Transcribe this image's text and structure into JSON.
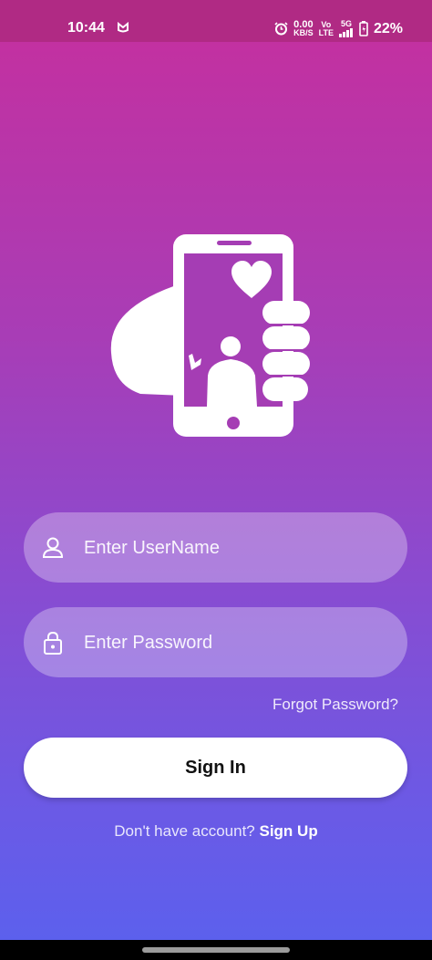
{
  "status_bar": {
    "time": "10:44",
    "network_speed_value": "0.00",
    "network_speed_unit": "KB/S",
    "volte_top": "Vo",
    "volte_bottom": "LTE",
    "network_type": "5G",
    "battery_percent": "22%"
  },
  "login": {
    "username_placeholder": "Enter UserName",
    "password_placeholder": "Enter Password",
    "forgot_password": "Forgot Password?",
    "sign_in": "Sign In",
    "no_account": "Don't have account?",
    "sign_up": "Sign Up"
  },
  "colors": {
    "gradient_top": "#c62f9e",
    "gradient_bottom": "#5a61ee",
    "status_bar": "#b02a84",
    "button_bg": "#ffffff"
  },
  "icons": [
    "alarm-icon",
    "signal-icon",
    "battery-icon",
    "app-logo-icon",
    "user-icon",
    "lock-icon"
  ]
}
